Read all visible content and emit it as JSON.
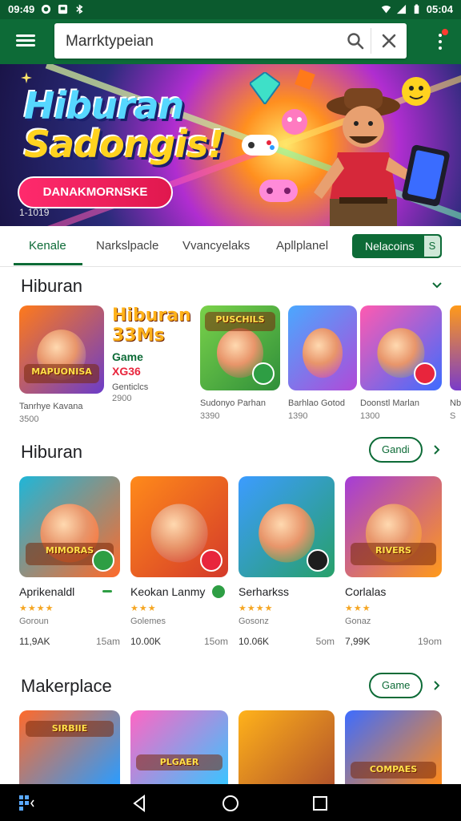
{
  "status": {
    "time_left": "09:49",
    "time_right": "05:04"
  },
  "search": {
    "value": "Marrktypeian"
  },
  "banner": {
    "title_line1": "Hiburan",
    "title_line2": "Sadongis!",
    "cta": "DANAKMORNSKE",
    "meta": "1-1019"
  },
  "tabs": [
    {
      "label": "Kenale"
    },
    {
      "label": "Narkslpacle"
    },
    {
      "label": "Vvancyelaks"
    },
    {
      "label": "Apllplanel"
    }
  ],
  "tab_pill": {
    "label": "Nelacoins",
    "cap": "S"
  },
  "section1": {
    "title": "Hiburan",
    "promo": {
      "title": "Hiburan",
      "sub": "33Ms",
      "game": "Game",
      "code": "XG36",
      "extra": "Genticlcs",
      "value": "2900"
    },
    "items": [
      {
        "name": "Tanrhye Kavana",
        "sub": "3500",
        "colors": [
          "#ff7a1a",
          "#6b3cc9"
        ],
        "caption": "MAPUONISA",
        "badge": ""
      },
      {
        "name": "Sudonyo Parhan",
        "sub": "3390",
        "colors": [
          "#7ad24a",
          "#2f8f3a"
        ],
        "caption": "PUSCHILS",
        "badge": "#2e9e44"
      },
      {
        "name": "Barhlao Gotod",
        "sub": "1390",
        "colors": [
          "#4aa8ff",
          "#b04ad8"
        ],
        "caption": "",
        "badge": ""
      },
      {
        "name": "Doonstl Marlan",
        "sub": "1300",
        "colors": [
          "#ff5ab0",
          "#3d6cff"
        ],
        "caption": "",
        "badge": "#e8253c"
      }
    ],
    "edge_labels": [
      "Nb",
      "S"
    ]
  },
  "section2": {
    "title": "Hiburan",
    "button": "Gandi",
    "items": [
      {
        "name": "Aprikenaldl",
        "sub": "Goroun",
        "size": "11,9AK",
        "time": "15am",
        "colors": [
          "#1fb6d8",
          "#ff6a2a"
        ],
        "caption": "MIMORAS",
        "badge": "#2e9e44"
      },
      {
        "name": "Keokan Lanmy",
        "sub": "Golemes",
        "size": "10.00K",
        "time": "15om",
        "colors": [
          "#ff8a1a",
          "#d43a2a"
        ],
        "caption": "",
        "badge": "#e8253c"
      },
      {
        "name": "Serharkss",
        "sub": "Gosonz",
        "size": "10.06K",
        "time": "5om",
        "colors": [
          "#3c9cff",
          "#28a06a"
        ],
        "caption": "",
        "badge": "#1d1d1d"
      },
      {
        "name": "Corlalas",
        "sub": "Gonaz",
        "size": "7,99K",
        "time": "19om",
        "colors": [
          "#a43cd8",
          "#ff9a1a"
        ],
        "caption": "RIVERS",
        "badge": ""
      }
    ]
  },
  "section3": {
    "title": "Makerplace",
    "button": "Game",
    "items": [
      {
        "colors": [
          "#ff6a2a",
          "#2a9cff"
        ],
        "caption": "SIRBIIE"
      },
      {
        "colors": [
          "#ff66c4",
          "#3ac4ff"
        ],
        "caption": "PLGAER"
      },
      {
        "colors": [
          "#ffb21a",
          "#b3542a"
        ],
        "caption": ""
      },
      {
        "colors": [
          "#3d6cff",
          "#ff8a1a"
        ],
        "caption": "COMPAES"
      }
    ]
  },
  "colors": {
    "primary": "#0d6b37",
    "status": "#0b5a2e",
    "accent": "#e8253c",
    "star": "#f5a623"
  }
}
